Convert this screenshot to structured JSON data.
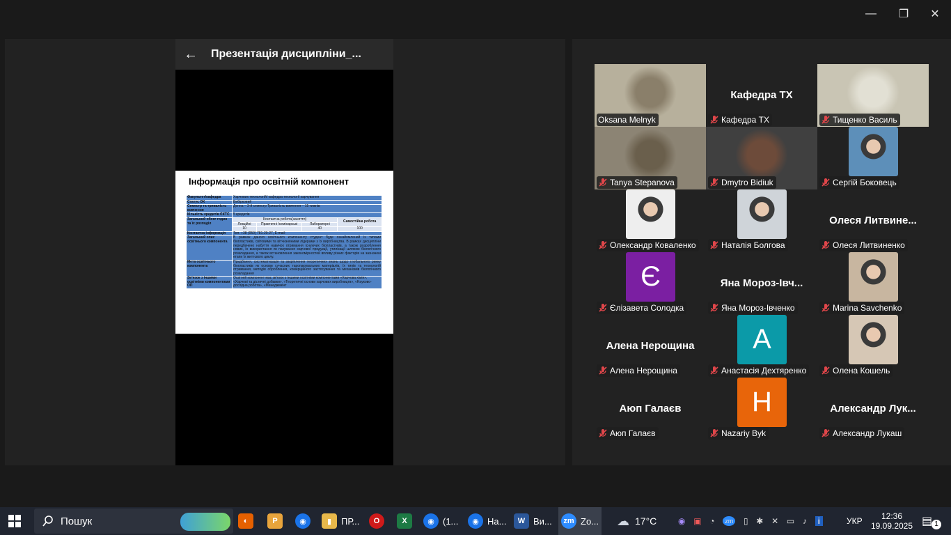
{
  "window": {
    "minimize_glyph": "—",
    "restore_glyph": "❐",
    "close_glyph": "✕"
  },
  "share": {
    "back_glyph": "←",
    "doc_title": "Презентація дисципліни_...",
    "slide_title": "Інформація про освітній компонент",
    "rows": [
      {
        "k": "Факультет/кафедра",
        "v": "Харчових технологій/ кафедра технології харчування"
      },
      {
        "k": "Статус ОК",
        "v": "Вибірковий"
      },
      {
        "k": "Семестр та тривалість вивчення",
        "v": "Денна – 3-й семестр Тривалість вивчення – 15 тижнів"
      },
      {
        "k": "Кількість кредитів ЄКТС",
        "v": "5 кредитів"
      },
      {
        "k": "Загальний обсяг годин та їх розподіл",
        "v": ""
      },
      {
        "k": "Контактна інформація",
        "v": "Тел. +38 (050) 781-20-27, E-mail:"
      },
      {
        "k": "Загальний опис освітнього компонента",
        "v": "В рамках даного освітнього компоненту студент буде ознайомлений із типами біопластиків, світовими та вітчизняними лідерами з їх виробництва. В рамках дисципліни передбачено набуття навичок отримання існуючих біопластиків, а також розроблення нових, їх використання як пакування харчової продукції, утилізації шляхом біологічного розкладання, а також встановлення закономірностей впливу різних факторів на зазначені етапи їх життєвого циклу."
      },
      {
        "k": "Мета освітнього компонента",
        "v": "Придбання, систематизація та закріплення теоретичних знань щодо глобального ринку біопластиків як основи сучасних таропакувальних матеріалів, їх типів та технологій отримання, методів оброблення, комерційного застосування та механізмів біологічного розкладання"
      },
      {
        "k": "Зв’язок з іншими освітніми компонентами ОП",
        "v": "Освітній компонент має зв’язок з іншими освітніми компонентами «Харчова хімія», «Харчові та дієтичні добавки», «Теоретичні основи харчових виробництв», «Науково-дослідна робота», «Менеджмент"
      }
    ],
    "hours": {
      "contact_header": "Контактна робота(заняття)",
      "lectures": "Лекційні",
      "practical": "Практичні /семінарські",
      "lab": "Лабораторні",
      "self": "Самостійна робота",
      "v_lectures": "10",
      "v_lab": "40",
      "v_self": "100"
    }
  },
  "participants": [
    {
      "name": "Oksana Melnyk",
      "type": "video",
      "muted": false
    },
    {
      "name": "Кафедра ТХ",
      "type": "name",
      "display": "Кафедра ТХ",
      "muted": true
    },
    {
      "name": "Тищенко Василь",
      "type": "video",
      "muted": true
    },
    {
      "name": "Tanya Stepanova",
      "type": "video",
      "muted": true
    },
    {
      "name": "Dmytro Bidiuk",
      "type": "video",
      "muted": true,
      "active": true
    },
    {
      "name": "Сергій Боковець",
      "type": "photo",
      "muted": true
    },
    {
      "name": "Олександр Коваленко",
      "type": "photo",
      "muted": true
    },
    {
      "name": "Наталія Болгова",
      "type": "photo",
      "muted": true
    },
    {
      "name": "Олеся Литвиненко",
      "type": "name",
      "display": "Олеся  Литвине...",
      "muted": true
    },
    {
      "name": "Єлізавета Солодка",
      "type": "avatar",
      "letter": "Є",
      "color": "#7b1fa2",
      "muted": true
    },
    {
      "name": "Яна Мороз-Івченко",
      "type": "name",
      "display": "Яна  Мороз-Івч...",
      "muted": true
    },
    {
      "name": "Marina Savchenko",
      "type": "photo",
      "muted": true
    },
    {
      "name": "Алена Нерощина",
      "type": "name",
      "display": "Алена Нерощина",
      "muted": true
    },
    {
      "name": "Анастасія Дехтяренко",
      "type": "avatar",
      "letter": "А",
      "color": "#0b9aa8",
      "muted": true
    },
    {
      "name": "Олена Кошель",
      "type": "photo",
      "muted": true
    },
    {
      "name": "Аюп Галаєв",
      "type": "name",
      "display": "Аюп Галаєв",
      "muted": true
    },
    {
      "name": "Nazariy Byk",
      "type": "avatar",
      "letter": "Н",
      "color": "#e8650a",
      "muted": true
    },
    {
      "name": "Александр Лукаш",
      "type": "name",
      "display": "Александр  Лук...",
      "muted": true
    }
  ],
  "taskbar": {
    "search_label": "Пошук",
    "apps": [
      {
        "name": "firefox-icon",
        "label": ""
      },
      {
        "name": "pdf-app-icon",
        "label": ""
      },
      {
        "name": "chrome-icon",
        "label": ""
      },
      {
        "name": "file-explorer-icon",
        "label": "ПР..."
      },
      {
        "name": "opera-icon",
        "label": ""
      },
      {
        "name": "excel-icon",
        "label": ""
      },
      {
        "name": "chrome-profile-icon",
        "label": "(1..."
      },
      {
        "name": "chrome-k-icon",
        "label": "На..."
      },
      {
        "name": "word-icon",
        "label": "Ви..."
      },
      {
        "name": "zoom-icon",
        "label": "Zo..."
      }
    ],
    "weather": "17°C",
    "language": "УКР",
    "time": "12:36",
    "date": "19.09.2025",
    "notifications": "1"
  }
}
